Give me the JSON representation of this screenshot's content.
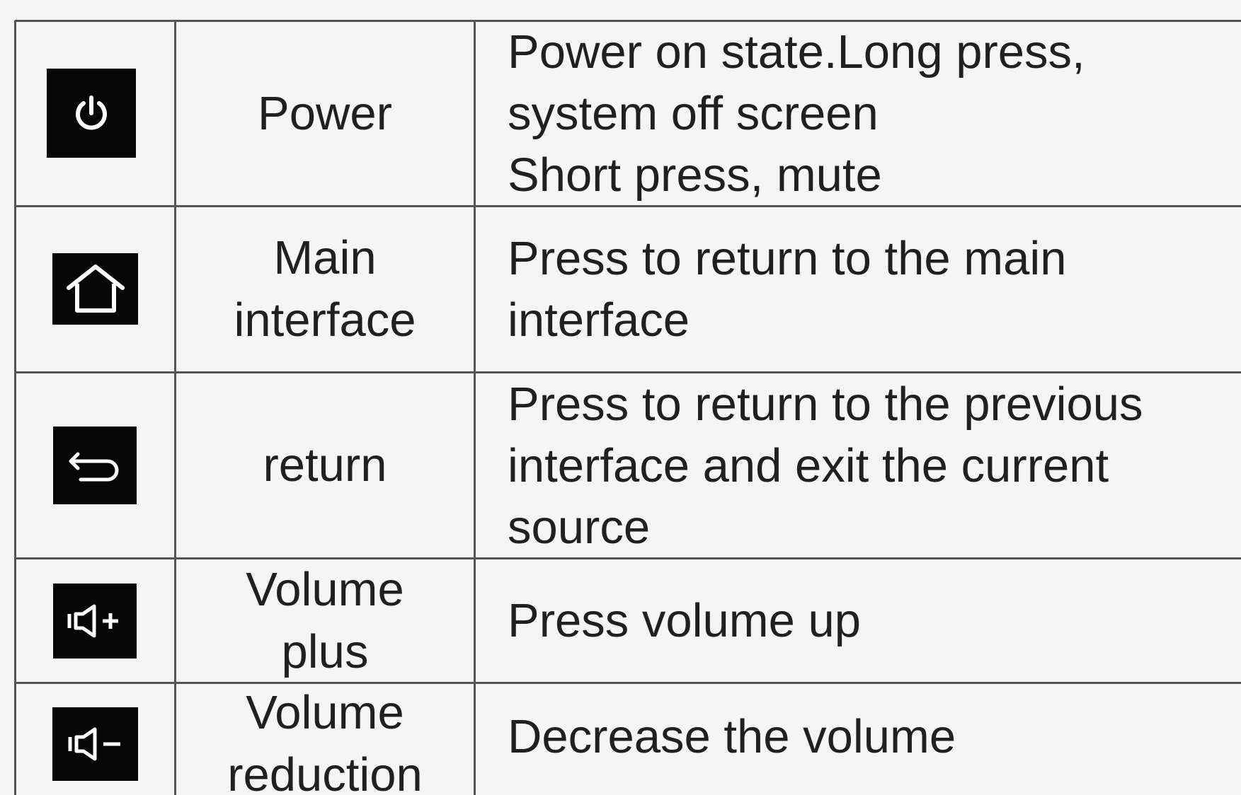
{
  "table": {
    "rows": [
      {
        "icon": "power-icon",
        "name": "Power",
        "description": "Power on state.Long press,\nsystem off screen\nShort press, mute"
      },
      {
        "icon": "home-icon",
        "name": "Main\ninterface",
        "description": "Press to return to the main\ninterface"
      },
      {
        "icon": "return-icon",
        "name": "return",
        "description": "Press to return to the previous\ninterface and exit the current\nsource"
      },
      {
        "icon": "volume-plus-icon",
        "name": "Volume\nplus",
        "description": "Press volume up"
      },
      {
        "icon": "volume-minus-icon",
        "name": "Volume\nreduction",
        "description": "Decrease the volume"
      }
    ]
  },
  "colors": {
    "background": "#f5f5f5",
    "border": "#555555",
    "icon_background": "#060606",
    "icon_glyph": "#ffffff",
    "text": "#202020"
  }
}
